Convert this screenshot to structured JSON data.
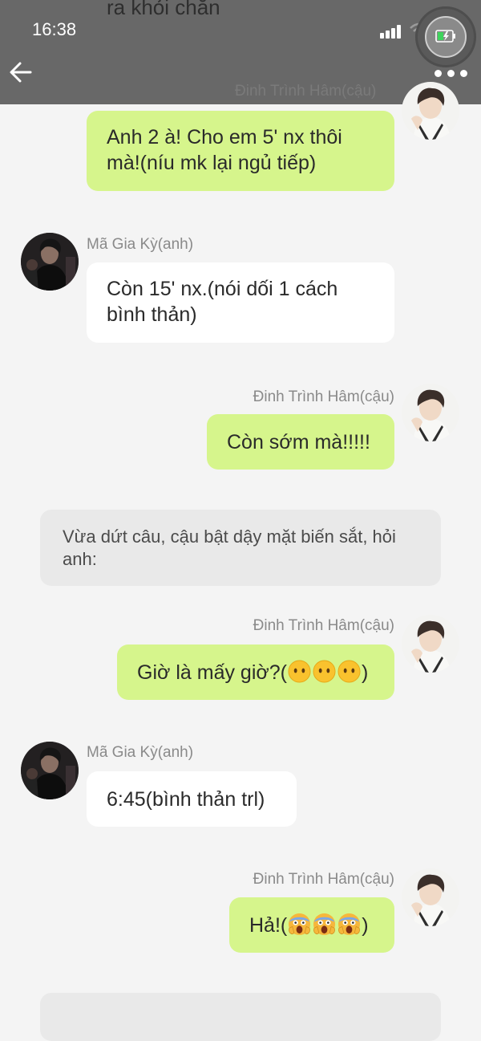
{
  "status_bar": {
    "time": "16:38"
  },
  "header": {
    "peek_text": "ra khỏi chăn",
    "peek_sender_name": "Đinh Trình Hâm(cậu)"
  },
  "messages": [
    {
      "sender": "Đinh Trình Hâm(cậu)",
      "side": "right",
      "text": "Anh 2 à! Cho em 5' nx thôi mà!(níu mk lại ngủ tiếp)"
    },
    {
      "sender": "Mã Gia Kỳ(anh)",
      "side": "left",
      "text": "Còn 15' nx.(nói dối 1 cách bình thản)"
    },
    {
      "sender": "Đinh Trình Hâm(cậu)",
      "side": "right",
      "text": "Còn sớm mà!!!!!"
    },
    {
      "narration": "Vừa dứt câu, cậu bật dậy mặt biến sắt, hỏi anh:"
    },
    {
      "sender": "Đinh Trình Hâm(cậu)",
      "side": "right",
      "text_before": "Giờ là mấy giờ?(",
      "text_after": ")",
      "emoji": "no-mouth-face",
      "emoji_count": 3
    },
    {
      "sender": "Mã Gia Kỳ(anh)",
      "side": "left",
      "text": "6:45(bình thản trl)"
    },
    {
      "sender": "Đinh Trình Hâm(cậu)",
      "side": "right",
      "text_before": "Hả!(",
      "text_after": ")",
      "emoji": "screaming-face",
      "emoji_count": 3
    }
  ],
  "icons": {
    "back": "arrow-left-icon",
    "more": "more-dots-icon",
    "signal": "signal-icon",
    "wifi": "wifi-icon",
    "battery": "battery-charging-icon"
  },
  "colors": {
    "header_bg": "#686868",
    "outgoing_bubble": "#d6f58c",
    "incoming_bubble": "#ffffff",
    "narration_bg": "#e9e9e9",
    "page_bg": "#f4f4f4"
  }
}
